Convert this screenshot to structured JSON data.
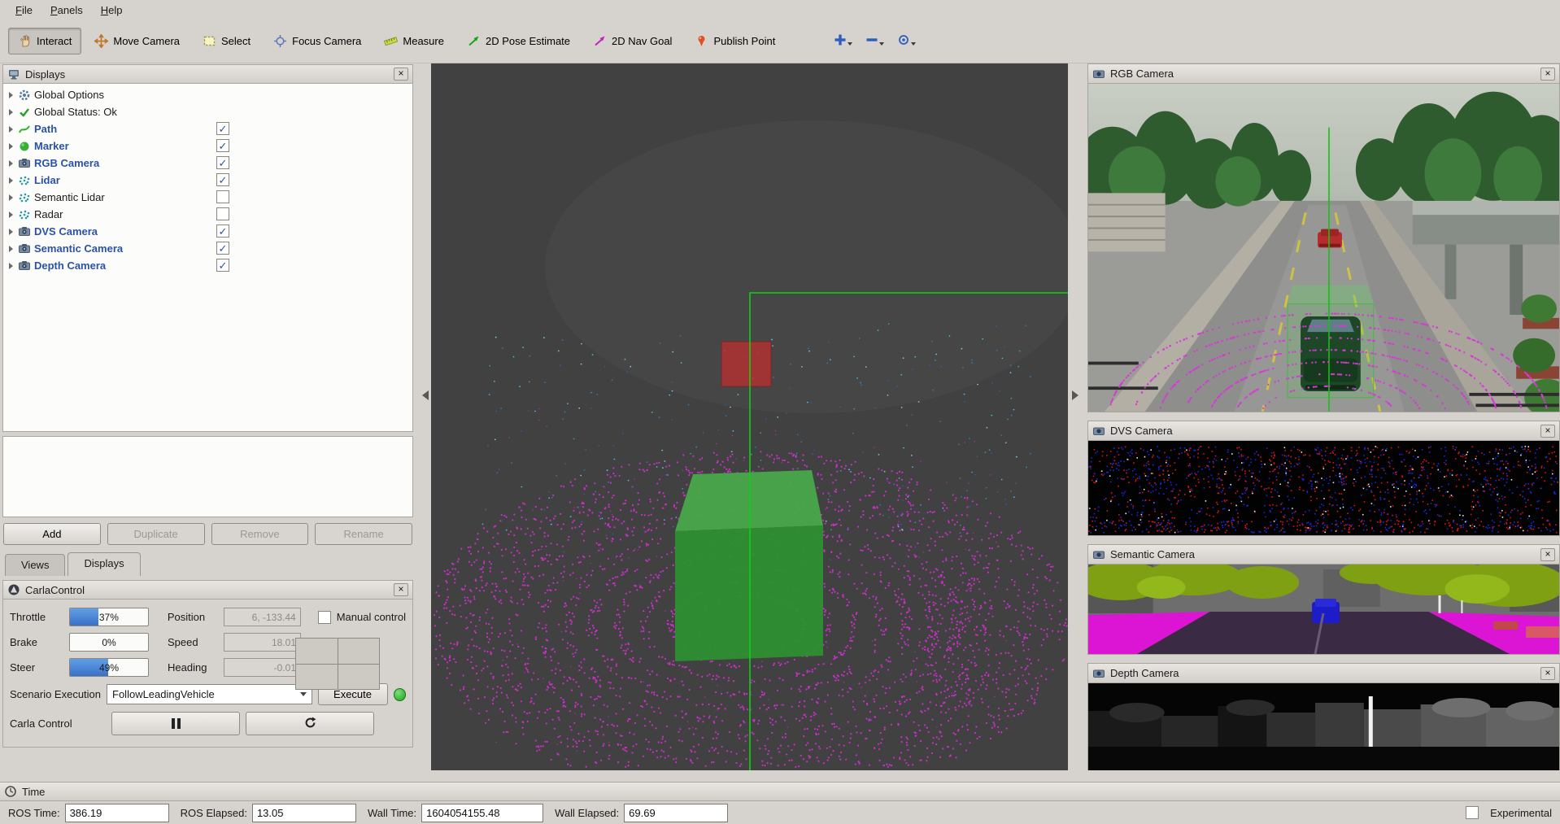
{
  "menubar": {
    "items": [
      "File",
      "Panels",
      "Help"
    ]
  },
  "toolbar": {
    "tools": [
      {
        "label": "Interact",
        "icon": "hand-icon",
        "active": true
      },
      {
        "label": "Move Camera",
        "icon": "move-camera-icon"
      },
      {
        "label": "Select",
        "icon": "select-box-icon"
      },
      {
        "label": "Focus Camera",
        "icon": "focus-camera-icon"
      },
      {
        "label": "Measure",
        "icon": "ruler-icon"
      },
      {
        "label": "2D Pose Estimate",
        "icon": "green-arrow-icon"
      },
      {
        "label": "2D Nav Goal",
        "icon": "magenta-arrow-icon"
      },
      {
        "label": "Publish Point",
        "icon": "point-pin-icon"
      }
    ]
  },
  "displays_panel": {
    "title": "Displays",
    "items": [
      {
        "label": "Global Options",
        "icon": "gear-icon",
        "checked": null
      },
      {
        "label": "Global Status: Ok",
        "icon": "check-icon",
        "checked": null
      },
      {
        "label": "Path",
        "icon": "path-icon",
        "checked": true
      },
      {
        "label": "Marker",
        "icon": "marker-icon",
        "checked": true
      },
      {
        "label": "RGB Camera",
        "icon": "camera-icon",
        "checked": true
      },
      {
        "label": "Lidar",
        "icon": "points-icon",
        "checked": true
      },
      {
        "label": "Semantic Lidar",
        "icon": "points-icon",
        "checked": false
      },
      {
        "label": "Radar",
        "icon": "points-icon",
        "checked": false
      },
      {
        "label": "DVS Camera",
        "icon": "camera-icon",
        "checked": true
      },
      {
        "label": "Semantic Camera",
        "icon": "camera-icon",
        "checked": true
      },
      {
        "label": "Depth Camera",
        "icon": "camera-icon",
        "checked": true
      }
    ],
    "buttons": {
      "add": "Add",
      "duplicate": "Duplicate",
      "remove": "Remove",
      "rename": "Rename"
    },
    "tabs": {
      "views": "Views",
      "displays": "Displays"
    },
    "active_tab": "Displays"
  },
  "carla_control": {
    "title": "CarlaControl",
    "throttle": {
      "label": "Throttle",
      "value": "37%",
      "pct": 37
    },
    "position": {
      "label": "Position",
      "value": "6, -133.44"
    },
    "manual_control_label": "Manual control",
    "manual_control_checked": false,
    "brake": {
      "label": "Brake",
      "value": "0%",
      "pct": 0
    },
    "speed": {
      "label": "Speed",
      "value": "18.01"
    },
    "steer": {
      "label": "Steer",
      "value": "49%",
      "pct": 49
    },
    "heading": {
      "label": "Heading",
      "value": "-0.01"
    },
    "scenario": {
      "label": "Scenario Execution",
      "value": "FollowLeadingVehicle",
      "execute_label": "Execute",
      "status_color": "#30c830"
    },
    "carla_control_label": "Carla Control"
  },
  "camera_panels": {
    "rgb": {
      "title": "RGB Camera"
    },
    "dvs": {
      "title": "DVS Camera"
    },
    "semantic": {
      "title": "Semantic Camera"
    },
    "depth": {
      "title": "Depth Camera"
    }
  },
  "time_panel": {
    "title": "Time",
    "fields": [
      {
        "label": "ROS Time:",
        "value": "386.19"
      },
      {
        "label": "ROS Elapsed:",
        "value": "13.05"
      },
      {
        "label": "Wall Time:",
        "value": "1604054155.48"
      },
      {
        "label": "Wall Elapsed:",
        "value": "69.69"
      }
    ],
    "experimental_label": "Experimental",
    "experimental_checked": false
  },
  "icons": {
    "close": "×"
  },
  "colors": {
    "lidar_magenta": "#cb2fcb",
    "path_green": "#12d012",
    "vehicle_green": "#2e8f31",
    "obstacle_red": "#b03030",
    "status_ok_green": "#30c830",
    "accent_blue": "#2a52a8",
    "viewport_bg": "#414141"
  }
}
